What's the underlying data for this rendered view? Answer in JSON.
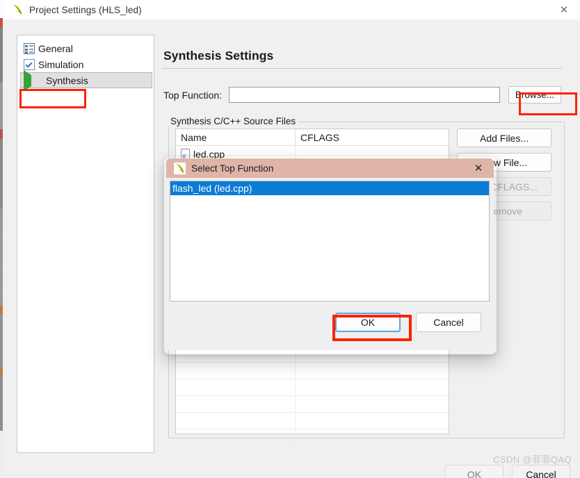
{
  "window": {
    "title": "Project Settings (HLS_led)",
    "icon": "vitis-leaf-icon",
    "close_label": "✕",
    "footer": {
      "ok_label": "OK",
      "cancel_label": "Cancel"
    }
  },
  "watermark": "CSDN @菲菲QAQ",
  "sidebar": {
    "items": [
      {
        "label": "General",
        "icon": "general-icon",
        "selected": false
      },
      {
        "label": "Simulation",
        "icon": "checkbox-icon",
        "selected": false
      },
      {
        "label": "Synthesis",
        "icon": "green-play-icon",
        "selected": true
      }
    ]
  },
  "pane": {
    "title": "Synthesis Settings",
    "top_function": {
      "label": "Top Function:",
      "value": "",
      "placeholder": "",
      "browse_label": "Browse..."
    },
    "group": {
      "legend": "Synthesis C/C++ Source Files",
      "columns": [
        "Name",
        "CFLAGS"
      ],
      "rows": [
        {
          "name": "led.cpp",
          "cflags": "",
          "icon": "c-file-icon"
        },
        {
          "name": "",
          "cflags": ""
        },
        {
          "name": "",
          "cflags": ""
        },
        {
          "name": "",
          "cflags": ""
        },
        {
          "name": "",
          "cflags": ""
        },
        {
          "name": "",
          "cflags": ""
        },
        {
          "name": "",
          "cflags": ""
        },
        {
          "name": "",
          "cflags": ""
        },
        {
          "name": "",
          "cflags": ""
        },
        {
          "name": "",
          "cflags": ""
        },
        {
          "name": "",
          "cflags": ""
        },
        {
          "name": "",
          "cflags": ""
        },
        {
          "name": "",
          "cflags": ""
        },
        {
          "name": "",
          "cflags": ""
        },
        {
          "name": "",
          "cflags": ""
        },
        {
          "name": "",
          "cflags": ""
        },
        {
          "name": "",
          "cflags": ""
        },
        {
          "name": "",
          "cflags": ""
        }
      ],
      "buttons": [
        {
          "label": "Add Files...",
          "enabled": true
        },
        {
          "label": "New File...",
          "enabled": true
        },
        {
          "label": "Edit CFLAGS...",
          "enabled": false
        },
        {
          "label": "Remove",
          "enabled": false
        }
      ]
    }
  },
  "modal": {
    "title": "Select Top Function",
    "icon": "vitis-leaf-icon",
    "close_label": "✕",
    "list": [
      {
        "label": "flash_led (led.cpp)",
        "selected": true
      }
    ],
    "ok_label": "OK",
    "cancel_label": "Cancel"
  },
  "annotations": {
    "highlight_color": "#fc2200",
    "boxes": [
      "sidebar-item-synthesis",
      "browse-button",
      "modal-ok-button"
    ]
  },
  "colors": {
    "accent_selection": "#0c7cd5",
    "modal_titlebar": "#dfb5a8",
    "window_bg": "#f0f0f0",
    "highlight": "#fc2200"
  }
}
